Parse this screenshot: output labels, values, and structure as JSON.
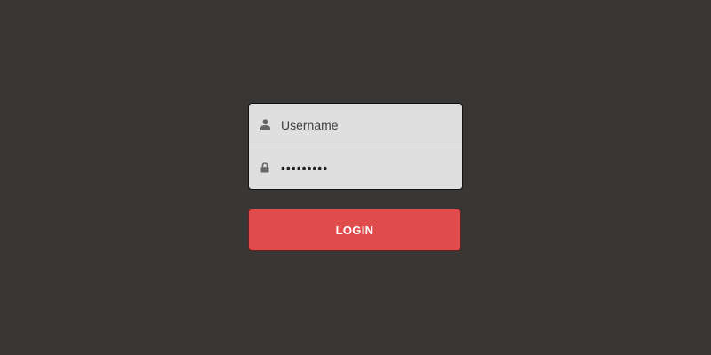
{
  "login_form": {
    "username": {
      "icon": "user-icon",
      "placeholder": "Username",
      "value": ""
    },
    "password": {
      "icon": "lock-icon",
      "value": "•••••••••"
    },
    "login_button": {
      "label": "LOGIN"
    }
  },
  "colors": {
    "background": "#383735",
    "field_background": "#dfdfdf",
    "button_background": "#e04b4b",
    "button_text": "#ffffff",
    "icon": "#666666"
  }
}
